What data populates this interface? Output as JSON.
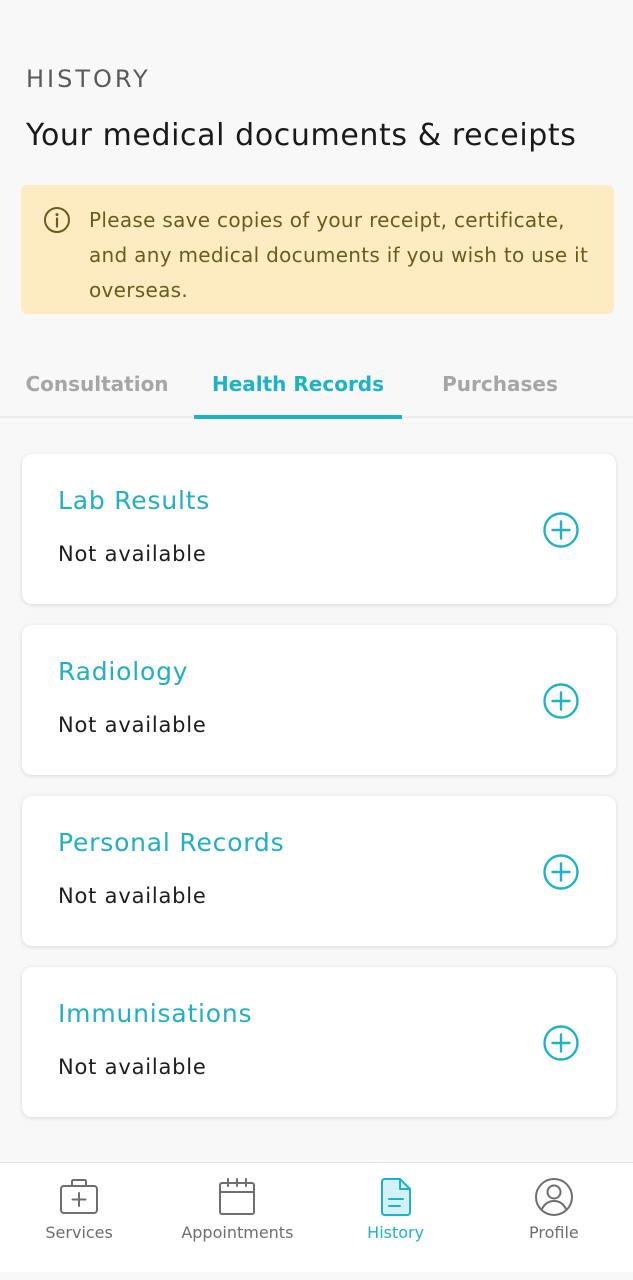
{
  "header": {
    "eyebrow": "HISTORY",
    "title": "Your medical documents & receipts"
  },
  "notice": {
    "icon": "info-icon",
    "text": "Please save copies of your receipt, certificate, and any medical documents if you wish to use it overseas."
  },
  "tabs": [
    {
      "label": "Consultation",
      "active": false
    },
    {
      "label": "Health Records",
      "active": true
    },
    {
      "label": "Purchases",
      "active": false
    }
  ],
  "records": [
    {
      "title": "Lab Results",
      "status": "Not available",
      "action_icon": "plus-circle-icon"
    },
    {
      "title": "Radiology",
      "status": "Not available",
      "action_icon": "plus-circle-icon"
    },
    {
      "title": "Personal Records",
      "status": "Not available",
      "action_icon": "plus-circle-icon"
    },
    {
      "title": "Immunisations",
      "status": "Not available",
      "action_icon": "plus-circle-icon"
    }
  ],
  "bottom_nav": [
    {
      "label": "Services",
      "icon": "medical-bag-icon",
      "active": false
    },
    {
      "label": "Appointments",
      "icon": "calendar-icon",
      "active": false
    },
    {
      "label": "History",
      "icon": "document-icon",
      "active": true
    },
    {
      "label": "Profile",
      "icon": "user-circle-icon",
      "active": false
    }
  ],
  "colors": {
    "accent": "#1cb3c8",
    "notice_bg": "#fdecc1",
    "notice_text": "#6e5a1c",
    "inactive": "#a6a6a6",
    "nav_inactive": "#6e6e6e"
  }
}
